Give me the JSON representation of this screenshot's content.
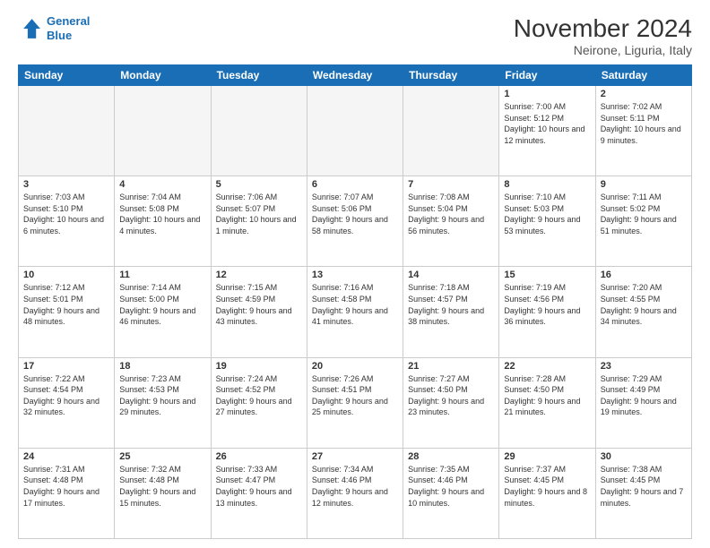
{
  "logo": {
    "line1": "General",
    "line2": "Blue"
  },
  "title": "November 2024",
  "subtitle": "Neirone, Liguria, Italy",
  "weekdays": [
    "Sunday",
    "Monday",
    "Tuesday",
    "Wednesday",
    "Thursday",
    "Friday",
    "Saturday"
  ],
  "weeks": [
    [
      {
        "day": "",
        "info": ""
      },
      {
        "day": "",
        "info": ""
      },
      {
        "day": "",
        "info": ""
      },
      {
        "day": "",
        "info": ""
      },
      {
        "day": "",
        "info": ""
      },
      {
        "day": "1",
        "info": "Sunrise: 7:00 AM\nSunset: 5:12 PM\nDaylight: 10 hours and 12 minutes."
      },
      {
        "day": "2",
        "info": "Sunrise: 7:02 AM\nSunset: 5:11 PM\nDaylight: 10 hours and 9 minutes."
      }
    ],
    [
      {
        "day": "3",
        "info": "Sunrise: 7:03 AM\nSunset: 5:10 PM\nDaylight: 10 hours and 6 minutes."
      },
      {
        "day": "4",
        "info": "Sunrise: 7:04 AM\nSunset: 5:08 PM\nDaylight: 10 hours and 4 minutes."
      },
      {
        "day": "5",
        "info": "Sunrise: 7:06 AM\nSunset: 5:07 PM\nDaylight: 10 hours and 1 minute."
      },
      {
        "day": "6",
        "info": "Sunrise: 7:07 AM\nSunset: 5:06 PM\nDaylight: 9 hours and 58 minutes."
      },
      {
        "day": "7",
        "info": "Sunrise: 7:08 AM\nSunset: 5:04 PM\nDaylight: 9 hours and 56 minutes."
      },
      {
        "day": "8",
        "info": "Sunrise: 7:10 AM\nSunset: 5:03 PM\nDaylight: 9 hours and 53 minutes."
      },
      {
        "day": "9",
        "info": "Sunrise: 7:11 AM\nSunset: 5:02 PM\nDaylight: 9 hours and 51 minutes."
      }
    ],
    [
      {
        "day": "10",
        "info": "Sunrise: 7:12 AM\nSunset: 5:01 PM\nDaylight: 9 hours and 48 minutes."
      },
      {
        "day": "11",
        "info": "Sunrise: 7:14 AM\nSunset: 5:00 PM\nDaylight: 9 hours and 46 minutes."
      },
      {
        "day": "12",
        "info": "Sunrise: 7:15 AM\nSunset: 4:59 PM\nDaylight: 9 hours and 43 minutes."
      },
      {
        "day": "13",
        "info": "Sunrise: 7:16 AM\nSunset: 4:58 PM\nDaylight: 9 hours and 41 minutes."
      },
      {
        "day": "14",
        "info": "Sunrise: 7:18 AM\nSunset: 4:57 PM\nDaylight: 9 hours and 38 minutes."
      },
      {
        "day": "15",
        "info": "Sunrise: 7:19 AM\nSunset: 4:56 PM\nDaylight: 9 hours and 36 minutes."
      },
      {
        "day": "16",
        "info": "Sunrise: 7:20 AM\nSunset: 4:55 PM\nDaylight: 9 hours and 34 minutes."
      }
    ],
    [
      {
        "day": "17",
        "info": "Sunrise: 7:22 AM\nSunset: 4:54 PM\nDaylight: 9 hours and 32 minutes."
      },
      {
        "day": "18",
        "info": "Sunrise: 7:23 AM\nSunset: 4:53 PM\nDaylight: 9 hours and 29 minutes."
      },
      {
        "day": "19",
        "info": "Sunrise: 7:24 AM\nSunset: 4:52 PM\nDaylight: 9 hours and 27 minutes."
      },
      {
        "day": "20",
        "info": "Sunrise: 7:26 AM\nSunset: 4:51 PM\nDaylight: 9 hours and 25 minutes."
      },
      {
        "day": "21",
        "info": "Sunrise: 7:27 AM\nSunset: 4:50 PM\nDaylight: 9 hours and 23 minutes."
      },
      {
        "day": "22",
        "info": "Sunrise: 7:28 AM\nSunset: 4:50 PM\nDaylight: 9 hours and 21 minutes."
      },
      {
        "day": "23",
        "info": "Sunrise: 7:29 AM\nSunset: 4:49 PM\nDaylight: 9 hours and 19 minutes."
      }
    ],
    [
      {
        "day": "24",
        "info": "Sunrise: 7:31 AM\nSunset: 4:48 PM\nDaylight: 9 hours and 17 minutes."
      },
      {
        "day": "25",
        "info": "Sunrise: 7:32 AM\nSunset: 4:48 PM\nDaylight: 9 hours and 15 minutes."
      },
      {
        "day": "26",
        "info": "Sunrise: 7:33 AM\nSunset: 4:47 PM\nDaylight: 9 hours and 13 minutes."
      },
      {
        "day": "27",
        "info": "Sunrise: 7:34 AM\nSunset: 4:46 PM\nDaylight: 9 hours and 12 minutes."
      },
      {
        "day": "28",
        "info": "Sunrise: 7:35 AM\nSunset: 4:46 PM\nDaylight: 9 hours and 10 minutes."
      },
      {
        "day": "29",
        "info": "Sunrise: 7:37 AM\nSunset: 4:45 PM\nDaylight: 9 hours and 8 minutes."
      },
      {
        "day": "30",
        "info": "Sunrise: 7:38 AM\nSunset: 4:45 PM\nDaylight: 9 hours and 7 minutes."
      }
    ]
  ]
}
